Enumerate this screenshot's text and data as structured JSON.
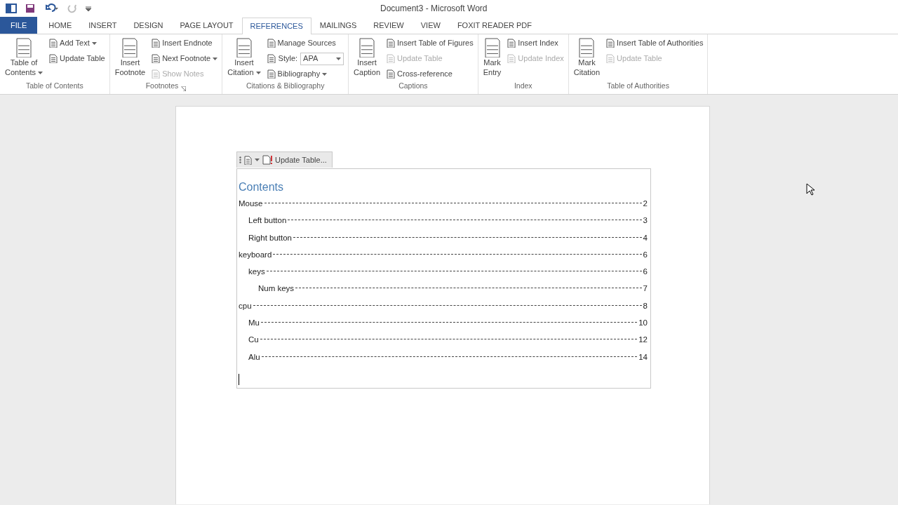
{
  "window": {
    "title": "Document3 - Microsoft Word"
  },
  "tabs": [
    {
      "label": "FILE",
      "kind": "file",
      "selected": false
    },
    {
      "label": "HOME",
      "kind": "tab",
      "selected": false
    },
    {
      "label": "INSERT",
      "kind": "tab",
      "selected": false
    },
    {
      "label": "DESIGN",
      "kind": "tab",
      "selected": false
    },
    {
      "label": "PAGE LAYOUT",
      "kind": "tab",
      "selected": false
    },
    {
      "label": "REFERENCES",
      "kind": "tab",
      "selected": true
    },
    {
      "label": "MAILINGS",
      "kind": "tab",
      "selected": false
    },
    {
      "label": "REVIEW",
      "kind": "tab",
      "selected": false
    },
    {
      "label": "VIEW",
      "kind": "tab",
      "selected": false
    },
    {
      "label": "FOXIT READER PDF",
      "kind": "tab",
      "selected": false
    }
  ],
  "ribbon_groups": [
    {
      "label": "Table of Contents",
      "launcher": false,
      "large": [
        {
          "lines": [
            "Table of",
            "Contents"
          ],
          "dropdown": true
        }
      ],
      "small": [
        {
          "kind": "button",
          "label": "Add Text",
          "dropdown": true,
          "disabled": false
        },
        {
          "kind": "button",
          "label": "Update Table",
          "dropdown": false,
          "disabled": false
        }
      ]
    },
    {
      "label": "Footnotes",
      "launcher": true,
      "large": [
        {
          "lines": [
            "Insert",
            "Footnote"
          ],
          "dropdown": false
        }
      ],
      "small": [
        {
          "kind": "button",
          "label": "Insert Endnote",
          "dropdown": false,
          "disabled": false
        },
        {
          "kind": "button",
          "label": "Next Footnote",
          "dropdown": true,
          "disabled": false
        },
        {
          "kind": "button",
          "label": "Show Notes",
          "dropdown": false,
          "disabled": true
        }
      ]
    },
    {
      "label": "Citations & Bibliography",
      "launcher": false,
      "large": [
        {
          "lines": [
            "Insert",
            "Citation"
          ],
          "dropdown": true
        }
      ],
      "small": [
        {
          "kind": "button",
          "label": "Manage Sources",
          "dropdown": false,
          "disabled": false
        },
        {
          "kind": "combo",
          "label": "Style:",
          "value": "APA"
        },
        {
          "kind": "button",
          "label": "Bibliography",
          "dropdown": true,
          "disabled": false
        }
      ]
    },
    {
      "label": "Captions",
      "launcher": false,
      "large": [
        {
          "lines": [
            "Insert",
            "Caption"
          ],
          "dropdown": false
        }
      ],
      "small": [
        {
          "kind": "button",
          "label": "Insert Table of Figures",
          "dropdown": false,
          "disabled": false
        },
        {
          "kind": "button",
          "label": "Update Table",
          "dropdown": false,
          "disabled": true
        },
        {
          "kind": "button",
          "label": "Cross-reference",
          "dropdown": false,
          "disabled": false
        }
      ]
    },
    {
      "label": "Index",
      "launcher": false,
      "large": [
        {
          "lines": [
            "Mark",
            "Entry"
          ],
          "dropdown": false
        }
      ],
      "small": [
        {
          "kind": "button",
          "label": "Insert Index",
          "dropdown": false,
          "disabled": false
        },
        {
          "kind": "button",
          "label": "Update Index",
          "dropdown": false,
          "disabled": true
        }
      ]
    },
    {
      "label": "Table of Authorities",
      "launcher": false,
      "large": [
        {
          "lines": [
            "Mark",
            "Citation"
          ],
          "dropdown": false
        }
      ],
      "small": [
        {
          "kind": "button",
          "label": "Insert Table of Authorities",
          "dropdown": false,
          "disabled": false
        },
        {
          "kind": "button",
          "label": "Update Table",
          "dropdown": false,
          "disabled": true
        }
      ]
    }
  ],
  "toc": {
    "toolbar_button": "Update Table...",
    "heading": "Contents",
    "entries": [
      {
        "text": "Mouse",
        "page": "2",
        "children": [
          {
            "text": "Left button",
            "page": "3"
          },
          {
            "text": "Right button",
            "page": "4"
          }
        ]
      },
      {
        "text": "keyboard",
        "page": "6",
        "children": [
          {
            "text": "keys",
            "page": "6",
            "children": [
              {
                "text": "Num keys",
                "page": "7"
              }
            ]
          }
        ]
      },
      {
        "text": "cpu",
        "page": "8",
        "children": [
          {
            "text": "Mu",
            "page": "10"
          },
          {
            "text": "Cu",
            "page": "12"
          },
          {
            "text": "Alu",
            "page": "14"
          }
        ]
      }
    ]
  }
}
